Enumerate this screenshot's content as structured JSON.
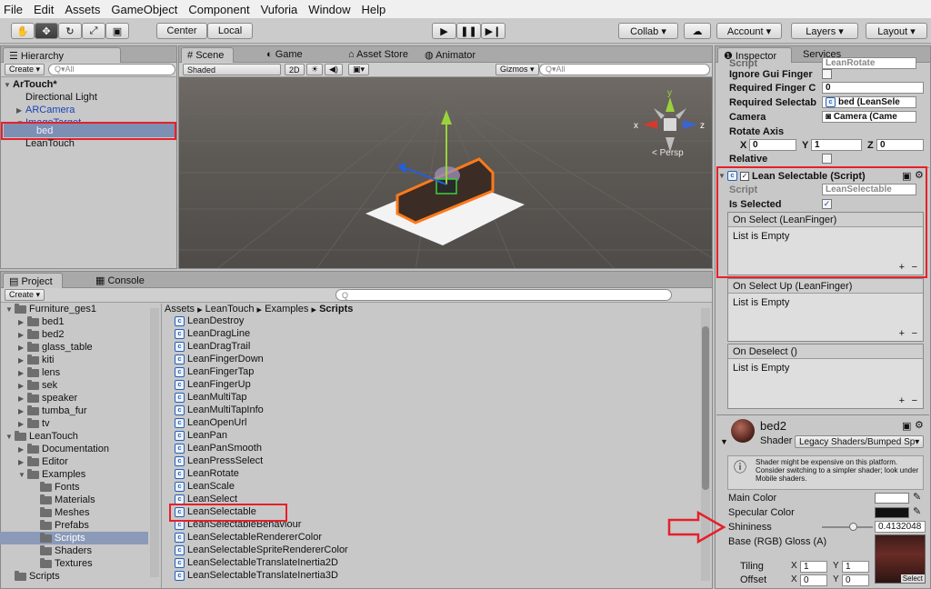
{
  "menu": [
    "File",
    "Edit",
    "Assets",
    "GameObject",
    "Component",
    "Vuforia",
    "Window",
    "Help"
  ],
  "toolbar": {
    "pivot_center": "Center",
    "pivot_local": "Local",
    "collab": "Collab ▾",
    "account": "Account ▾",
    "layers": "Layers ▾",
    "layout": "Layout ▾"
  },
  "hierarchy": {
    "tab": "Hierarchy",
    "create": "Create ▾",
    "search_placeholder": "Q▾All",
    "scene_name": "ArTouch*",
    "items": [
      "Directional Light",
      "ARCamera",
      "ImageTarget",
      "bed",
      "LeanTouch"
    ]
  },
  "scene": {
    "tabs": [
      "Scene",
      "Game",
      "Asset Store",
      "Animator"
    ],
    "shading": "Shaded",
    "mode_2d": "2D",
    "gizmos": "Gizmos ▾",
    "search_placeholder": "Q▾All",
    "persp": "< Persp",
    "axes": {
      "x": "x",
      "y": "y",
      "z": "z"
    }
  },
  "project": {
    "tabs": [
      "Project",
      "Console"
    ],
    "create": "Create ▾",
    "breadcrumb": [
      "Assets",
      "LeanTouch",
      "Examples",
      "Scripts"
    ],
    "tree": [
      {
        "label": "Furniture_ges1",
        "depth": 0,
        "expanded": true
      },
      {
        "label": "bed1",
        "depth": 1
      },
      {
        "label": "bed2",
        "depth": 1
      },
      {
        "label": "glass_table",
        "depth": 1
      },
      {
        "label": "kiti",
        "depth": 1
      },
      {
        "label": "lens",
        "depth": 1
      },
      {
        "label": "sek",
        "depth": 1
      },
      {
        "label": "speaker",
        "depth": 1
      },
      {
        "label": "tumba_fur",
        "depth": 1
      },
      {
        "label": "tv",
        "depth": 1
      },
      {
        "label": "LeanTouch",
        "depth": 0,
        "expanded": true
      },
      {
        "label": "Documentation",
        "depth": 1
      },
      {
        "label": "Editor",
        "depth": 1
      },
      {
        "label": "Examples",
        "depth": 1,
        "expanded": true
      },
      {
        "label": "Fonts",
        "depth": 2
      },
      {
        "label": "Materials",
        "depth": 2
      },
      {
        "label": "Meshes",
        "depth": 2
      },
      {
        "label": "Prefabs",
        "depth": 2
      },
      {
        "label": "Scripts",
        "depth": 2,
        "selected": true
      },
      {
        "label": "Shaders",
        "depth": 2
      },
      {
        "label": "Textures",
        "depth": 2
      },
      {
        "label": "Scripts",
        "depth": 0
      }
    ],
    "scripts": [
      "LeanDestroy",
      "LeanDragLine",
      "LeanDragTrail",
      "LeanFingerDown",
      "LeanFingerTap",
      "LeanFingerUp",
      "LeanMultiTap",
      "LeanMultiTapInfo",
      "LeanOpenUrl",
      "LeanPan",
      "LeanPanSmooth",
      "LeanPressSelect",
      "LeanRotate",
      "LeanScale",
      "LeanSelect",
      "LeanSelectable",
      "LeanSelectableBehaviour",
      "LeanSelectableRendererColor",
      "LeanSelectableSpriteRendererColor",
      "LeanSelectableTranslateInertia2D",
      "LeanSelectableTranslateInertia3D"
    ]
  },
  "inspector": {
    "tabs": [
      "Inspector",
      "Services"
    ],
    "top_cut_script": "Script",
    "top_cut_value": "LeanRotate",
    "ignore_gui": "Ignore Gui Finger",
    "required_finger": "Required Finger C",
    "required_finger_value": "0",
    "required_selectable": "Required Selectab",
    "required_selectable_value": "bed (LeanSele",
    "camera": "Camera",
    "camera_value": "Camera (Came",
    "rotate_axis": "Rotate Axis",
    "axis_x_label": "X",
    "axis_x": "0",
    "axis_y_label": "Y",
    "axis_y": "1",
    "axis_z_label": "Z",
    "axis_z": "0",
    "relative": "Relative",
    "component_title": "Lean Selectable (Script)",
    "script_label": "Script",
    "script_value": "LeanSelectable",
    "is_selected": "Is Selected",
    "events": [
      {
        "head": "On Select (LeanFinger)",
        "body": "List is Empty"
      },
      {
        "head": "On Select Up (LeanFinger)",
        "body": "List is Empty"
      },
      {
        "head": "On Deselect ()",
        "body": "List is Empty"
      }
    ],
    "material_name": "bed2",
    "shader_label": "Shader",
    "shader_value": "Legacy Shaders/Bumped Sp▾",
    "warning": "Shader might be expensive on this platform. Consider switching to a simpler shader; look under Mobile shaders.",
    "main_color": "Main Color",
    "specular_color": "Specular Color",
    "shininess": "Shininess",
    "shininess_value": "0.4132048",
    "base_label": "Base (RGB) Gloss (A)",
    "tiling": "Tiling",
    "offset": "Offset",
    "tiling_x": "1",
    "tiling_y": "1",
    "offset_x": "0",
    "offset_y": "0",
    "x_lbl": "X",
    "y_lbl": "Y",
    "select_btn": "Select",
    "plus": "+",
    "minus": "−"
  },
  "colors": {
    "highlight_red": "#e6202a",
    "selection_blue": "#3d6bbd",
    "scene_bg": "#5a5652"
  }
}
